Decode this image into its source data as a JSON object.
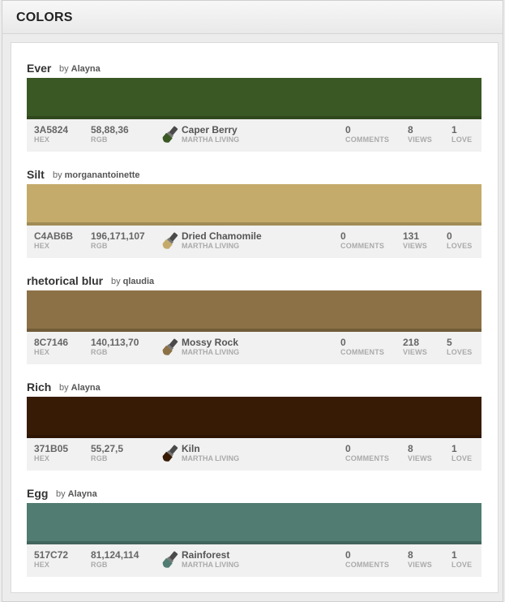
{
  "header": {
    "title": "COLORS"
  },
  "by_word": "by",
  "colors": [
    {
      "name": "Ever",
      "author": "Alayna",
      "swatch": "#3A5824",
      "hex": "3A5824",
      "hex_label": "HEX",
      "rgb": "58,88,36",
      "rgb_label": "RGB",
      "paint_name": "Caper Berry",
      "brand": "MARTHA LIVING",
      "comments": "0",
      "comments_label": "COMMENTS",
      "views": "8",
      "views_label": "VIEWS",
      "loves": "1",
      "loves_label": "LOVE",
      "icon": "paintbrush-icon"
    },
    {
      "name": "Silt",
      "author": "morganantoinette",
      "swatch": "#C4AB6B",
      "hex": "C4AB6B",
      "hex_label": "HEX",
      "rgb": "196,171,107",
      "rgb_label": "RGB",
      "paint_name": "Dried Chamomile",
      "brand": "MARTHA LIVING",
      "comments": "0",
      "comments_label": "COMMENTS",
      "views": "131",
      "views_label": "VIEWS",
      "loves": "0",
      "loves_label": "LOVES",
      "icon": "paintbrush-icon"
    },
    {
      "name": "rhetorical blur",
      "author": "qlaudia",
      "swatch": "#8C7146",
      "hex": "8C7146",
      "hex_label": "HEX",
      "rgb": "140,113,70",
      "rgb_label": "RGB",
      "paint_name": "Mossy Rock",
      "brand": "MARTHA LIVING",
      "comments": "0",
      "comments_label": "COMMENTS",
      "views": "218",
      "views_label": "VIEWS",
      "loves": "5",
      "loves_label": "LOVES",
      "icon": "paintbrush-icon"
    },
    {
      "name": "Rich",
      "author": "Alayna",
      "swatch": "#371B05",
      "hex": "371B05",
      "hex_label": "HEX",
      "rgb": "55,27,5",
      "rgb_label": "RGB",
      "paint_name": "Kiln",
      "brand": "MARTHA LIVING",
      "comments": "0",
      "comments_label": "COMMENTS",
      "views": "8",
      "views_label": "VIEWS",
      "loves": "1",
      "loves_label": "LOVE",
      "icon": "paintbrush-icon"
    },
    {
      "name": "Egg",
      "author": "Alayna",
      "swatch": "#517C72",
      "hex": "517C72",
      "hex_label": "HEX",
      "rgb": "81,124,114",
      "rgb_label": "RGB",
      "paint_name": "Rainforest",
      "brand": "MARTHA LIVING",
      "comments": "0",
      "comments_label": "COMMENTS",
      "views": "8",
      "views_label": "VIEWS",
      "loves": "1",
      "loves_label": "LOVE",
      "icon": "paintbrush-icon"
    }
  ]
}
